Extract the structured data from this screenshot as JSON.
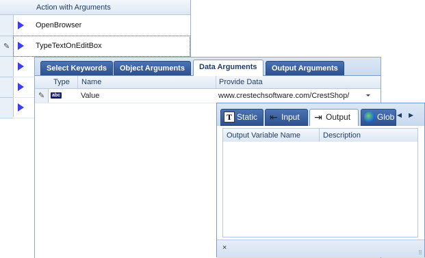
{
  "main_grid": {
    "header": "Action with Arguments",
    "rows": [
      {
        "label": "OpenBrowser"
      },
      {
        "label": "TypeTextOnEditBox"
      },
      {
        "label": ""
      },
      {
        "label": ""
      },
      {
        "label": ""
      }
    ]
  },
  "args_panel": {
    "tabs": [
      "Select Keywords",
      "Object Arguments",
      "Data Arguments",
      "Output Arguments"
    ],
    "active_tab": "Data Arguments",
    "columns": [
      "Type",
      "Name",
      "Provide Data"
    ],
    "row": {
      "type_icon": "abc",
      "name": "Value",
      "data": "www.crestechsoftware.com/CrestShop/"
    }
  },
  "popup": {
    "tabs": [
      {
        "label": "Static",
        "icon": "static-text-icon"
      },
      {
        "label": "Input",
        "icon": "input-icon"
      },
      {
        "label": "Output",
        "icon": "output-icon"
      },
      {
        "label": "Glob",
        "icon": "globe-icon"
      }
    ],
    "active_tab": "Output",
    "columns": [
      "Output Variable Name",
      "Description"
    ],
    "close_label": "×"
  },
  "colors": {
    "tab_blue": "#2c4f8f",
    "arrow_blue": "#3d3df0",
    "header_bg": "#dde7f3"
  }
}
